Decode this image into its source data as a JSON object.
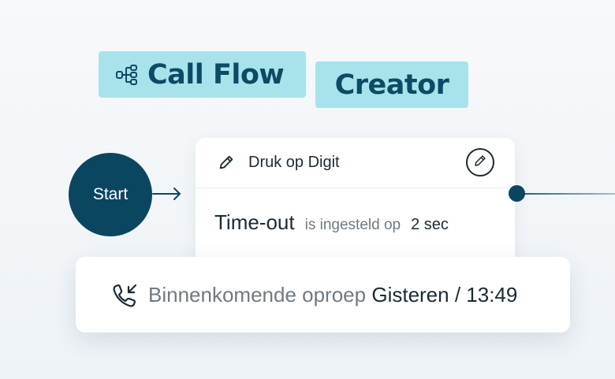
{
  "header": {
    "title_part1": "Call Flow",
    "title_part2": "Creator",
    "icon": "flow-diagram-icon"
  },
  "start_node": {
    "label": "Start"
  },
  "card": {
    "title": "Druk op Digit",
    "title_icon": "pencil-icon",
    "edit_icon": "pencil-circle-icon",
    "timeout": {
      "label": "Time-out",
      "text": "is ingesteld op",
      "value": "2 sec"
    }
  },
  "notification": {
    "icon": "incoming-call-icon",
    "label": "Binnenkomende oproep",
    "time": "Gisteren / 13:49"
  },
  "colors": {
    "accent": "#0b4660",
    "badge_bg": "#a8e3ec",
    "badge_text": "#0d4a64"
  }
}
